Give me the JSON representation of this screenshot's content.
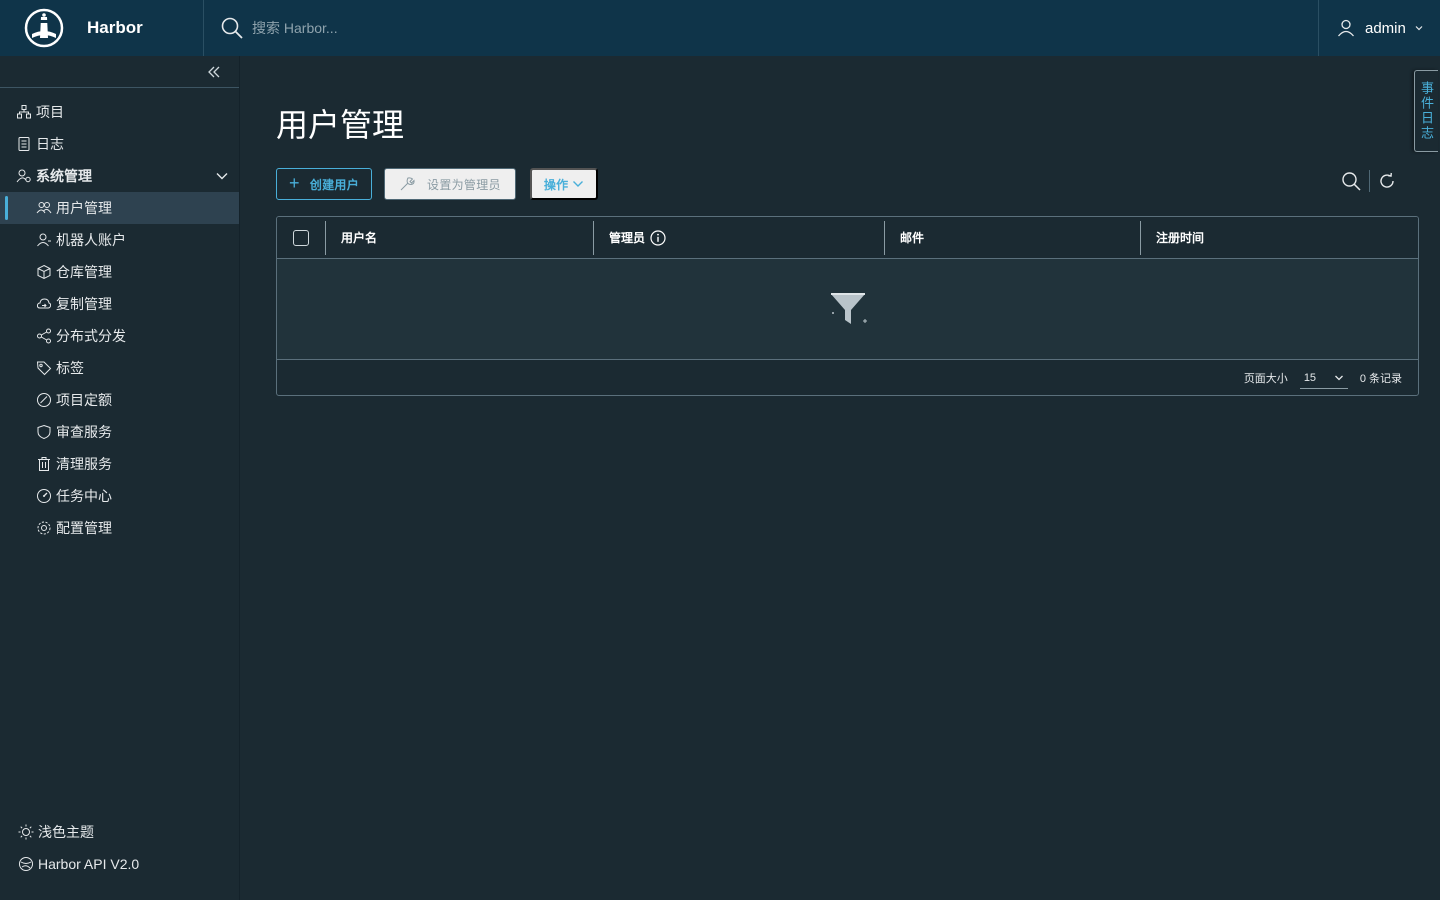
{
  "header": {
    "brand": "Harbor",
    "search_placeholder": "搜索 Harbor...",
    "user": "admin"
  },
  "sidebar": {
    "top_items": [
      {
        "label": "项目",
        "icon": "projects-icon"
      },
      {
        "label": "日志",
        "icon": "logs-icon"
      }
    ],
    "group": {
      "label": "系统管理",
      "icon": "admin-icon",
      "expanded": true
    },
    "sub_items": [
      {
        "label": "用户管理",
        "icon": "users-icon",
        "active": true
      },
      {
        "label": "机器人账户",
        "icon": "robot-icon"
      },
      {
        "label": "仓库管理",
        "icon": "registry-icon"
      },
      {
        "label": "复制管理",
        "icon": "replication-icon"
      },
      {
        "label": "分布式分发",
        "icon": "distribution-icon"
      },
      {
        "label": "标签",
        "icon": "tag-icon"
      },
      {
        "label": "项目定额",
        "icon": "quota-icon"
      },
      {
        "label": "审查服务",
        "icon": "shield-icon"
      },
      {
        "label": "清理服务",
        "icon": "trash-icon"
      },
      {
        "label": "任务中心",
        "icon": "job-icon"
      },
      {
        "label": "配置管理",
        "icon": "gear-icon"
      }
    ],
    "bottom_items": [
      {
        "label": "浅色主题",
        "icon": "sun-icon"
      },
      {
        "label": "Harbor API V2.0",
        "icon": "api-icon"
      }
    ]
  },
  "main": {
    "title": "用户管理",
    "toolbar": {
      "create_user": "创建用户",
      "set_admin": "设置为管理员",
      "actions": "操作"
    },
    "table": {
      "columns": [
        "用户名",
        "管理员",
        "邮件",
        "注册时间"
      ],
      "rows": []
    },
    "footer": {
      "page_size_label": "页面大小",
      "page_size": "15",
      "total": "0 条记录"
    }
  },
  "event_log": "事件日志",
  "colors": {
    "header_bg": "#0f3449",
    "body_bg": "#1b2a32",
    "accent": "#49afd9"
  }
}
